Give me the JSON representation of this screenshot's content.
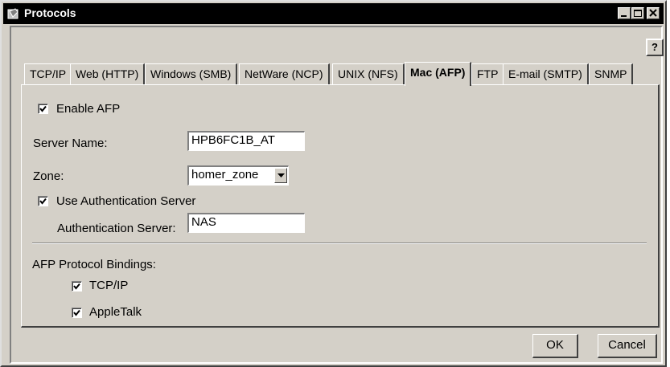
{
  "window": {
    "title": "Protocols"
  },
  "help": {
    "label": "?"
  },
  "tabs": [
    {
      "label": "TCP/IP"
    },
    {
      "label": "Web (HTTP)"
    },
    {
      "label": "Windows (SMB)"
    },
    {
      "label": "NetWare (NCP)"
    },
    {
      "label": "UNIX (NFS)"
    },
    {
      "label": "Mac (AFP)",
      "active": true
    },
    {
      "label": "FTP"
    },
    {
      "label": "E-mail (SMTP)"
    },
    {
      "label": "SNMP"
    }
  ],
  "afp": {
    "enable_label": "Enable AFP",
    "enable_checked": true,
    "server_name_label": "Server Name:",
    "server_name_value": "HPB6FC1B_AT",
    "zone_label": "Zone:",
    "zone_value": "homer_zone",
    "use_auth_label": "Use Authentication Server",
    "use_auth_checked": true,
    "auth_server_label": "Authentication Server:",
    "auth_server_value": "NAS",
    "bindings_label": "AFP Protocol Bindings:",
    "bindings": [
      {
        "label": "TCP/IP",
        "checked": true
      },
      {
        "label": "AppleTalk",
        "checked": true
      }
    ]
  },
  "buttons": {
    "ok": "OK",
    "cancel": "Cancel"
  }
}
